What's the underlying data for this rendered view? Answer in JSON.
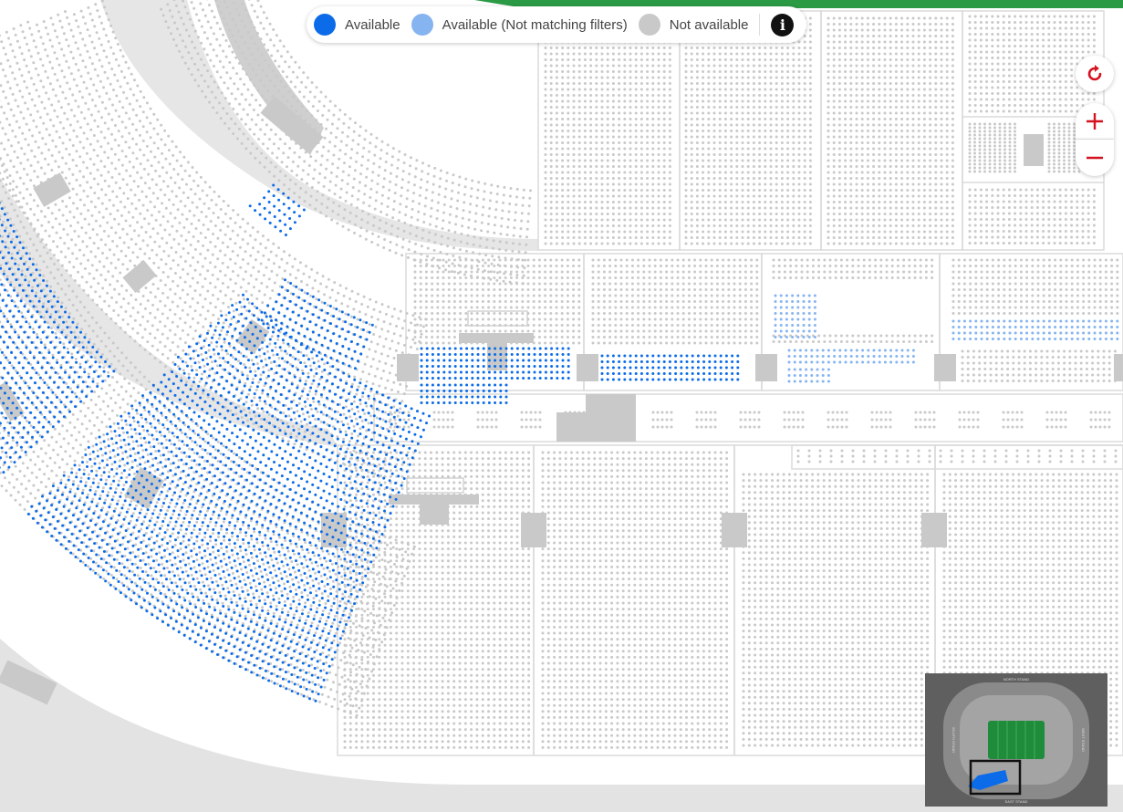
{
  "legend": {
    "available": "Available",
    "available_not_matching": "Available (Not matching filters)",
    "not_available": "Not available",
    "info_icon": "info-icon"
  },
  "controls": {
    "reset_icon": "reset-icon",
    "zoom_in_icon": "plus-icon",
    "zoom_out_icon": "minus-icon"
  },
  "colors": {
    "available": "#0b6be8",
    "available_not_matching": "#86b4f0",
    "not_available": "#c9c9c9",
    "control_red": "#d5121f",
    "pitch_green": "#1e8c3a"
  },
  "minimap": {
    "top_label": "NORTH STAND",
    "bottom_label": "EAST STAND",
    "left_label": "SOUTH STAND",
    "right_label": "WEST STAND"
  }
}
